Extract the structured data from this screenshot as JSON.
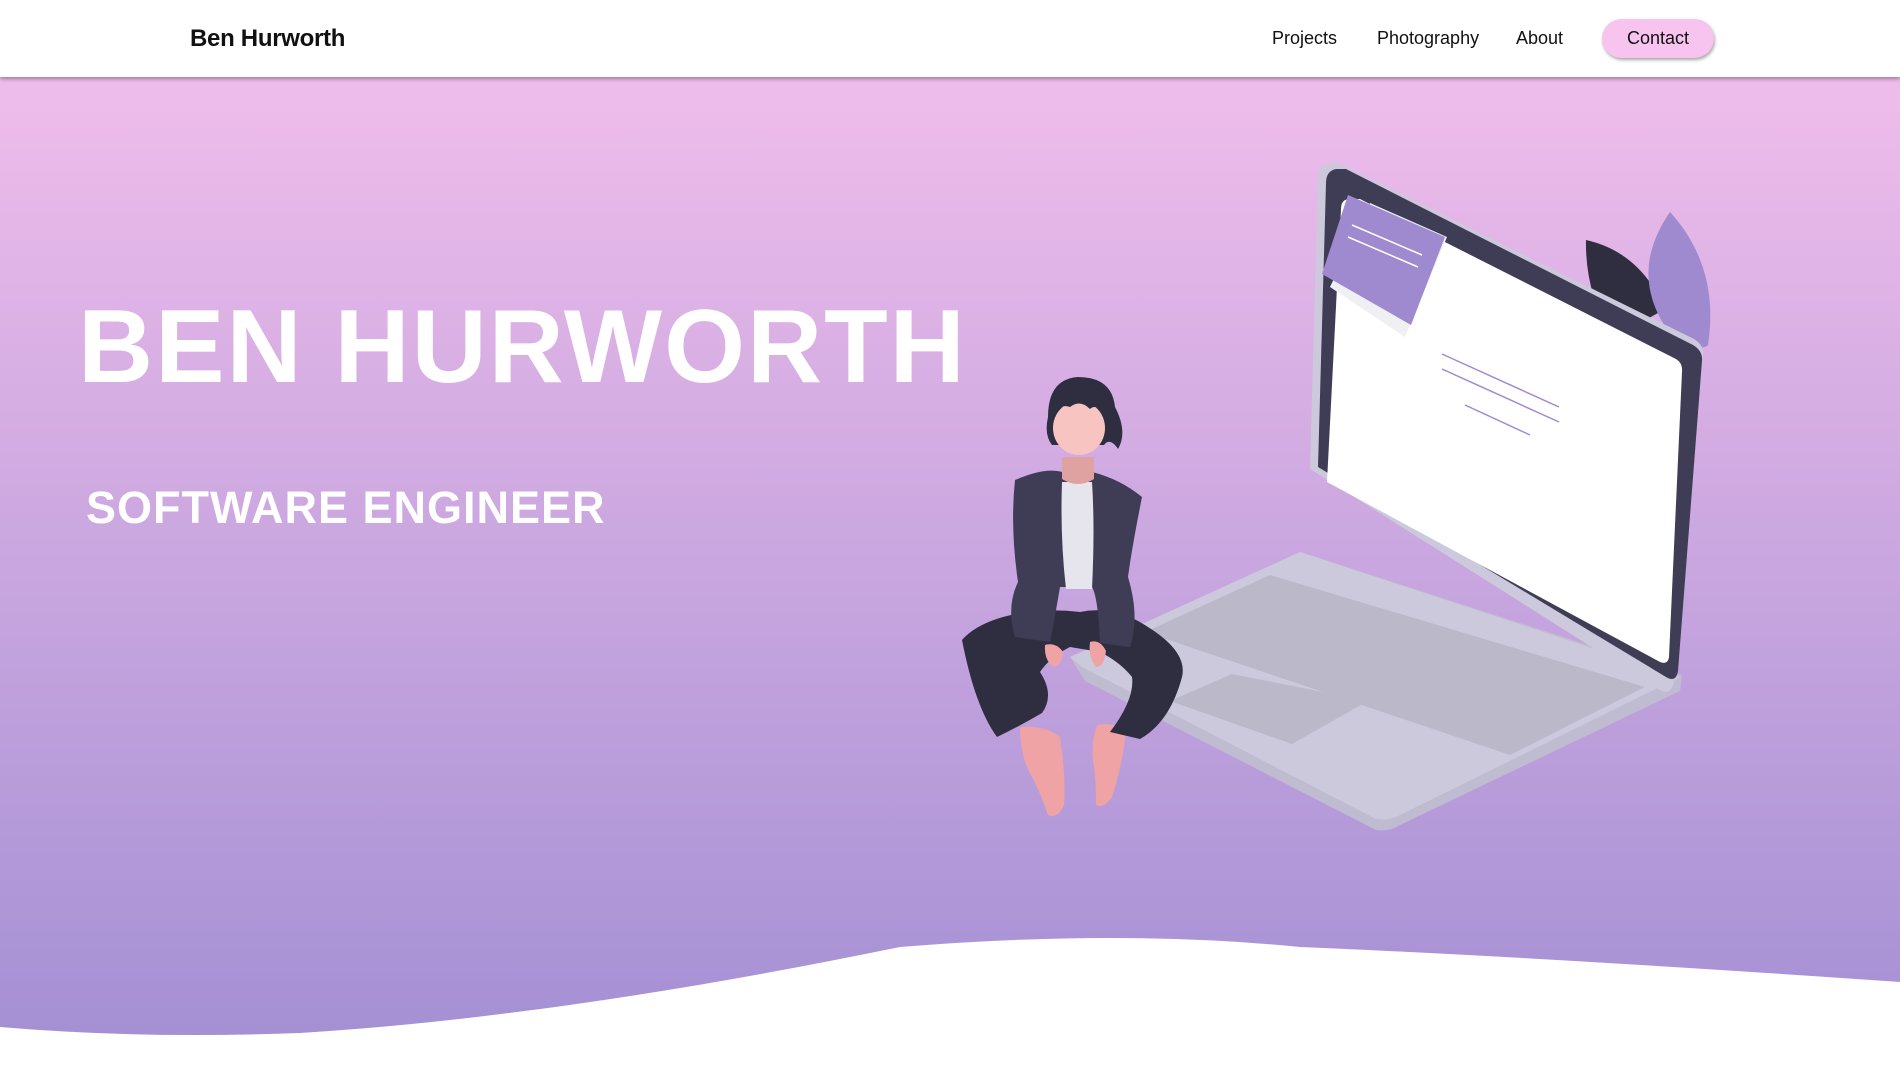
{
  "nav": {
    "brand": "Ben Hurworth",
    "links": [
      "Projects",
      "Photography",
      "About"
    ],
    "contact": "Contact"
  },
  "hero": {
    "name": "BEN HURWORTH",
    "subtitle": "SOFTWARE ENGINEER"
  },
  "colors": {
    "gradient_top": "#efbdeb",
    "gradient_bottom": "#a18ed3",
    "contact_button": "#f7c4ef",
    "laptop_frame": "#3f3d56",
    "laptop_base": "#cdc9dd",
    "accent": "#9f8ad0"
  }
}
